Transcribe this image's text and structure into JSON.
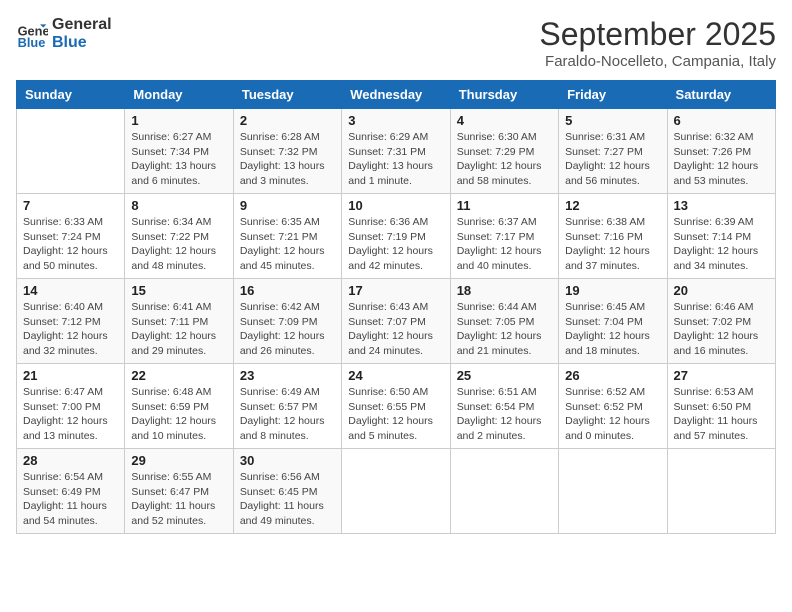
{
  "header": {
    "logo_line1": "General",
    "logo_line2": "Blue",
    "month": "September 2025",
    "location": "Faraldo-Nocelleto, Campania, Italy"
  },
  "days_of_week": [
    "Sunday",
    "Monday",
    "Tuesday",
    "Wednesday",
    "Thursday",
    "Friday",
    "Saturday"
  ],
  "weeks": [
    [
      {
        "day": "",
        "info": ""
      },
      {
        "day": "1",
        "info": "Sunrise: 6:27 AM\nSunset: 7:34 PM\nDaylight: 13 hours\nand 6 minutes."
      },
      {
        "day": "2",
        "info": "Sunrise: 6:28 AM\nSunset: 7:32 PM\nDaylight: 13 hours\nand 3 minutes."
      },
      {
        "day": "3",
        "info": "Sunrise: 6:29 AM\nSunset: 7:31 PM\nDaylight: 13 hours\nand 1 minute."
      },
      {
        "day": "4",
        "info": "Sunrise: 6:30 AM\nSunset: 7:29 PM\nDaylight: 12 hours\nand 58 minutes."
      },
      {
        "day": "5",
        "info": "Sunrise: 6:31 AM\nSunset: 7:27 PM\nDaylight: 12 hours\nand 56 minutes."
      },
      {
        "day": "6",
        "info": "Sunrise: 6:32 AM\nSunset: 7:26 PM\nDaylight: 12 hours\nand 53 minutes."
      }
    ],
    [
      {
        "day": "7",
        "info": "Sunrise: 6:33 AM\nSunset: 7:24 PM\nDaylight: 12 hours\nand 50 minutes."
      },
      {
        "day": "8",
        "info": "Sunrise: 6:34 AM\nSunset: 7:22 PM\nDaylight: 12 hours\nand 48 minutes."
      },
      {
        "day": "9",
        "info": "Sunrise: 6:35 AM\nSunset: 7:21 PM\nDaylight: 12 hours\nand 45 minutes."
      },
      {
        "day": "10",
        "info": "Sunrise: 6:36 AM\nSunset: 7:19 PM\nDaylight: 12 hours\nand 42 minutes."
      },
      {
        "day": "11",
        "info": "Sunrise: 6:37 AM\nSunset: 7:17 PM\nDaylight: 12 hours\nand 40 minutes."
      },
      {
        "day": "12",
        "info": "Sunrise: 6:38 AM\nSunset: 7:16 PM\nDaylight: 12 hours\nand 37 minutes."
      },
      {
        "day": "13",
        "info": "Sunrise: 6:39 AM\nSunset: 7:14 PM\nDaylight: 12 hours\nand 34 minutes."
      }
    ],
    [
      {
        "day": "14",
        "info": "Sunrise: 6:40 AM\nSunset: 7:12 PM\nDaylight: 12 hours\nand 32 minutes."
      },
      {
        "day": "15",
        "info": "Sunrise: 6:41 AM\nSunset: 7:11 PM\nDaylight: 12 hours\nand 29 minutes."
      },
      {
        "day": "16",
        "info": "Sunrise: 6:42 AM\nSunset: 7:09 PM\nDaylight: 12 hours\nand 26 minutes."
      },
      {
        "day": "17",
        "info": "Sunrise: 6:43 AM\nSunset: 7:07 PM\nDaylight: 12 hours\nand 24 minutes."
      },
      {
        "day": "18",
        "info": "Sunrise: 6:44 AM\nSunset: 7:05 PM\nDaylight: 12 hours\nand 21 minutes."
      },
      {
        "day": "19",
        "info": "Sunrise: 6:45 AM\nSunset: 7:04 PM\nDaylight: 12 hours\nand 18 minutes."
      },
      {
        "day": "20",
        "info": "Sunrise: 6:46 AM\nSunset: 7:02 PM\nDaylight: 12 hours\nand 16 minutes."
      }
    ],
    [
      {
        "day": "21",
        "info": "Sunrise: 6:47 AM\nSunset: 7:00 PM\nDaylight: 12 hours\nand 13 minutes."
      },
      {
        "day": "22",
        "info": "Sunrise: 6:48 AM\nSunset: 6:59 PM\nDaylight: 12 hours\nand 10 minutes."
      },
      {
        "day": "23",
        "info": "Sunrise: 6:49 AM\nSunset: 6:57 PM\nDaylight: 12 hours\nand 8 minutes."
      },
      {
        "day": "24",
        "info": "Sunrise: 6:50 AM\nSunset: 6:55 PM\nDaylight: 12 hours\nand 5 minutes."
      },
      {
        "day": "25",
        "info": "Sunrise: 6:51 AM\nSunset: 6:54 PM\nDaylight: 12 hours\nand 2 minutes."
      },
      {
        "day": "26",
        "info": "Sunrise: 6:52 AM\nSunset: 6:52 PM\nDaylight: 12 hours\nand 0 minutes."
      },
      {
        "day": "27",
        "info": "Sunrise: 6:53 AM\nSunset: 6:50 PM\nDaylight: 11 hours\nand 57 minutes."
      }
    ],
    [
      {
        "day": "28",
        "info": "Sunrise: 6:54 AM\nSunset: 6:49 PM\nDaylight: 11 hours\nand 54 minutes."
      },
      {
        "day": "29",
        "info": "Sunrise: 6:55 AM\nSunset: 6:47 PM\nDaylight: 11 hours\nand 52 minutes."
      },
      {
        "day": "30",
        "info": "Sunrise: 6:56 AM\nSunset: 6:45 PM\nDaylight: 11 hours\nand 49 minutes."
      },
      {
        "day": "",
        "info": ""
      },
      {
        "day": "",
        "info": ""
      },
      {
        "day": "",
        "info": ""
      },
      {
        "day": "",
        "info": ""
      }
    ]
  ]
}
